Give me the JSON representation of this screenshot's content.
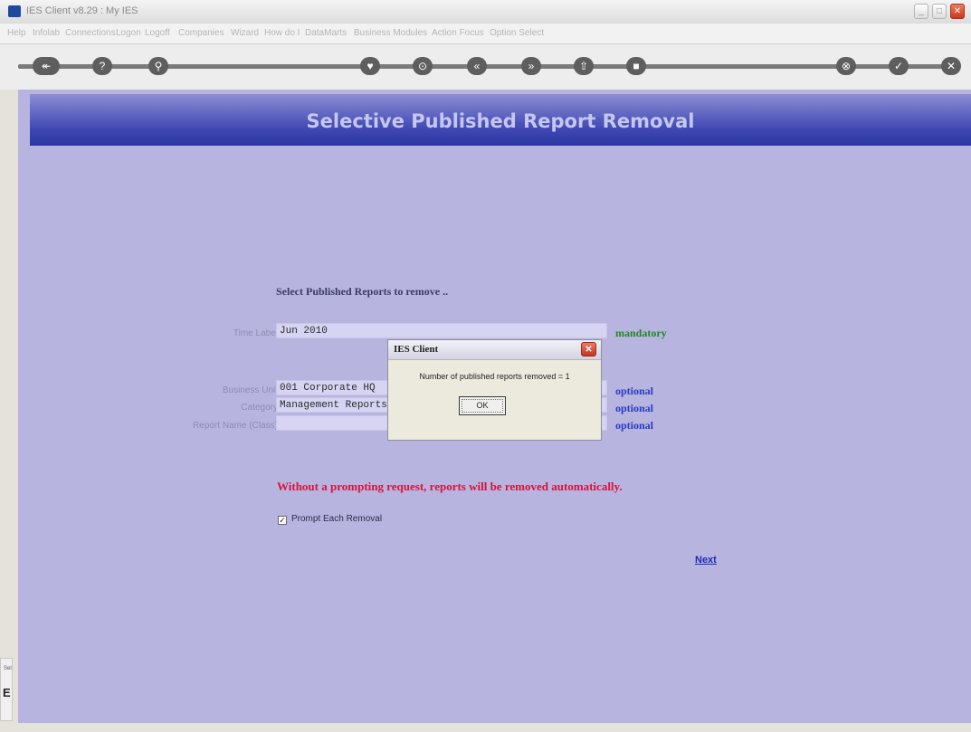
{
  "window": {
    "title": "IES Client v8.29 : My IES",
    "minimize": "_",
    "maximize": "□",
    "close": "✕"
  },
  "menu": [
    "Help",
    "Infolab",
    "Connections",
    "Logon",
    "Logoff",
    "Companies",
    "Wizard",
    "How do I",
    "DataMarts",
    "Business Modules",
    "Action Focus",
    "Option Select"
  ],
  "toolbar": {
    "buttons": [
      "↞",
      "?",
      "⚲",
      "♥",
      "⊙",
      "«",
      "»",
      "⇧",
      "■",
      "⊗",
      "✓",
      "✕"
    ]
  },
  "page": {
    "title": "Selective Published Report Removal",
    "section_title": "Select Published Reports to remove ..",
    "fields": [
      {
        "label": "Time Label",
        "value": "Jun 2010",
        "tag": "mandatory"
      },
      {
        "label": "Business Unit",
        "value": "001 Corporate HQ",
        "tag": "optional"
      },
      {
        "label": "Category",
        "value": "Management Reports",
        "tag": "optional"
      },
      {
        "label": "Report Name (Class)",
        "value": "",
        "tag": "optional"
      }
    ],
    "warning": "Without a prompting request, reports will be removed automatically.",
    "checkbox": {
      "label": "Prompt Each Removal",
      "checked": true,
      "mark": "✓"
    },
    "next_link": "Next"
  },
  "dialog": {
    "title": "IES Client",
    "message": "Number of published reports removed = 1",
    "ok_label": "OK",
    "close": "✕"
  },
  "side_panel": {
    "text": "Sel",
    "letter": "E"
  }
}
